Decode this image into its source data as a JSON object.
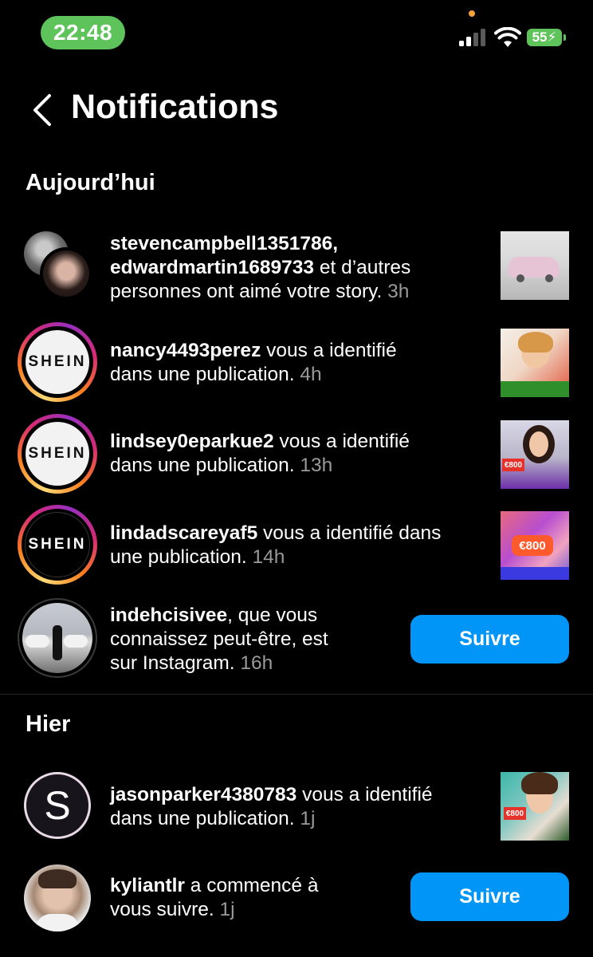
{
  "status_bar": {
    "time": "22:48",
    "battery": "55"
  },
  "header": {
    "title": "Notifications"
  },
  "sections": {
    "today": "Aujourd’hui",
    "yesterday": "Hier"
  },
  "notifications": [
    {
      "user": "stevencampbell1351786,",
      "user2": "edwardmartin1689733",
      "text_a": " et d’autres",
      "text_b": "personnes ont aimé votre story.",
      "time": "3h"
    },
    {
      "user": "nancy4493perez",
      "text_a": " vous a identifié",
      "text_b": "dans une publication.",
      "time": "4h",
      "avatar_label": "SHEIN"
    },
    {
      "user": "lindsey0eparkue2",
      "text_a": " vous a identifié",
      "text_b": "dans une publication.",
      "time": "13h",
      "avatar_label": "SHEIN"
    },
    {
      "user": "lindadscareyaf5",
      "text_a": " vous a identifié dans",
      "text_b": "une publication.",
      "time": "14h",
      "avatar_label": "SHEIN"
    },
    {
      "user": "indehcisivee",
      "text_a": ", que vous",
      "text_b": "connaissez peut-être, est",
      "text_c": "sur Instagram.",
      "time": "16h",
      "button": "Suivre"
    },
    {
      "user": "jasonparker4380783",
      "text_a": " vous a identifié",
      "text_b": "dans une publication.",
      "time": "1j",
      "avatar_label": "S"
    },
    {
      "user": "kyliantlr",
      "text_a": " a commencé à",
      "text_b": "vous suivre.",
      "time": "1j",
      "button": "Suivre"
    }
  ],
  "thumb_text": {
    "price1": "€800",
    "price2": "€800",
    "price3": "€800"
  },
  "colors": {
    "follow_button": "#0095f6",
    "status_green": "#5ec35a",
    "timestamp": "#9a9a9a"
  }
}
